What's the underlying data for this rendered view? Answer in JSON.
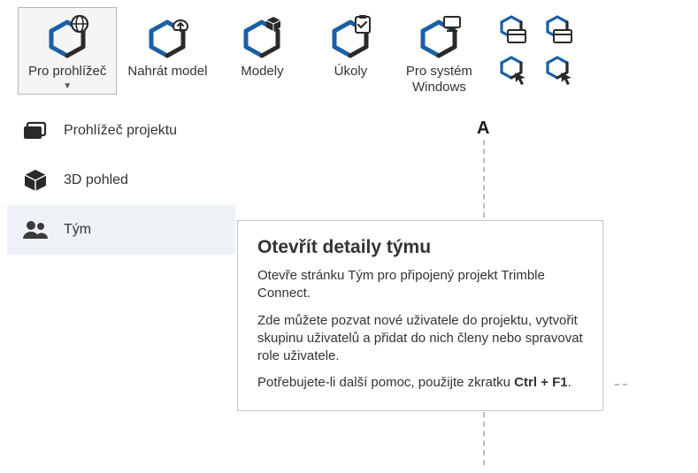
{
  "colors": {
    "accent": "#1b5fa6",
    "dark": "#2a2a2a"
  },
  "toolbar": {
    "items": [
      {
        "label": "Pro prohlížeč",
        "has_dropdown": true
      },
      {
        "label": "Nahrát model"
      },
      {
        "label": "Modely"
      },
      {
        "label": "Úkoly"
      },
      {
        "label": "Pro systém\nWindows"
      }
    ]
  },
  "dropdown": {
    "items": [
      {
        "label": "Prohlížeč projektu"
      },
      {
        "label": "3D pohled"
      },
      {
        "label": "Tým"
      }
    ]
  },
  "tooltip": {
    "title": "Otevřít detaily týmu",
    "p1": "Otevře stránku Tým pro připojený projekt Trimble Connect.",
    "p2": "Zde můžete pozvat nové uživatele do projektu, vytvořit skupinu uživatelů a přidat do nich členy nebo spravovat role uživatele.",
    "p3_prefix": "Potřebujete-li další pomoc, použijte zkratku ",
    "p3_key": "Ctrl + F1",
    "p3_suffix": "."
  },
  "canvas": {
    "marker": "A"
  }
}
